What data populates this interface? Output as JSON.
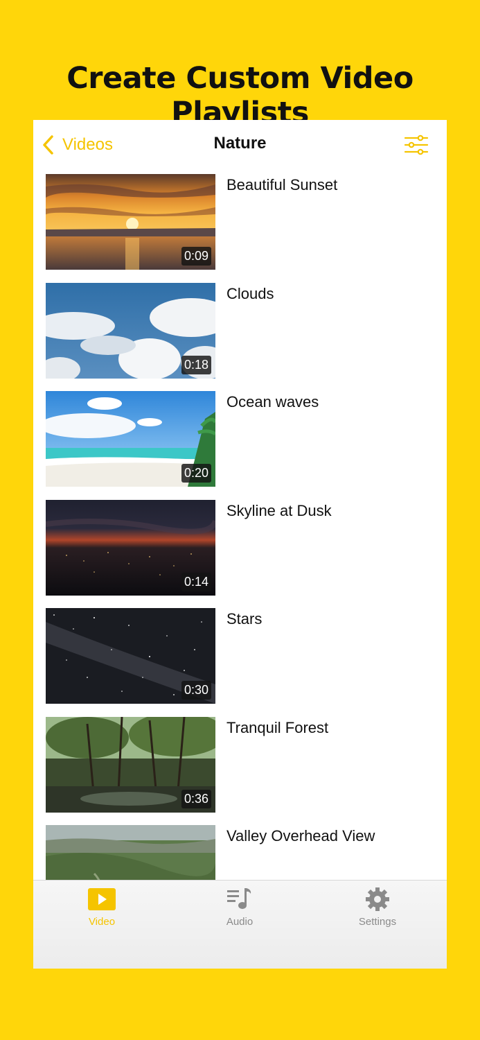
{
  "headline": "Create Custom Video Playlists",
  "colors": {
    "background": "#FFD60A",
    "accent": "#F5C400",
    "inactive": "#8a8a8a"
  },
  "navbar": {
    "back_label": "Videos",
    "back_icon": "chevron-left-icon",
    "title": "Nature",
    "filter_icon": "sliders-icon"
  },
  "videos": [
    {
      "title": "Beautiful Sunset",
      "duration": "0:09"
    },
    {
      "title": "Clouds",
      "duration": "0:18"
    },
    {
      "title": "Ocean waves",
      "duration": "0:20"
    },
    {
      "title": "Skyline at Dusk",
      "duration": "0:14"
    },
    {
      "title": "Stars",
      "duration": "0:30"
    },
    {
      "title": "Tranquil Forest",
      "duration": "0:36"
    },
    {
      "title": "Valley Overhead View",
      "duration": ""
    }
  ],
  "tabbar": {
    "tabs": [
      {
        "label": "Video",
        "icon": "video-play-icon",
        "active": true
      },
      {
        "label": "Audio",
        "icon": "music-list-icon",
        "active": false
      },
      {
        "label": "Settings",
        "icon": "gear-icon",
        "active": false
      }
    ]
  }
}
